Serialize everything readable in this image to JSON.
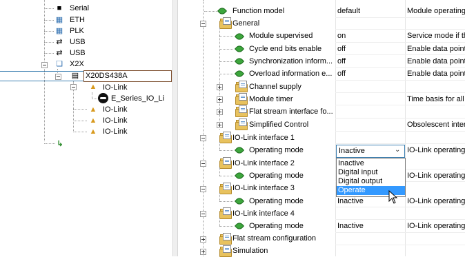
{
  "left_tree": {
    "items": [
      {
        "label": "Serial",
        "icon": "serial-port-icon"
      },
      {
        "label": "ETH",
        "icon": "ethernet-icon"
      },
      {
        "label": "PLK",
        "icon": "powerlink-icon"
      },
      {
        "label": "USB",
        "icon": "usb-icon"
      },
      {
        "label": "USB",
        "icon": "usb-icon"
      },
      {
        "label": "X2X",
        "icon": "x2x-icon"
      },
      {
        "label": "X20DS438A",
        "icon": "module-icon"
      },
      {
        "label": "IO-Link",
        "icon": "io-link-icon"
      },
      {
        "label": "E_Series_IO_Li",
        "icon": "sensor-icon"
      },
      {
        "label": "IO-Link",
        "icon": "io-link-icon"
      },
      {
        "label": "IO-Link",
        "icon": "io-link-icon"
      },
      {
        "label": "IO-Link",
        "icon": "io-link-icon"
      }
    ]
  },
  "config_rows": [
    {
      "name": "Function model",
      "value": "default",
      "description": "Module operating"
    },
    {
      "name": "General",
      "value": "",
      "description": ""
    },
    {
      "name": "Module supervised",
      "value": "on",
      "description": "Service mode if th"
    },
    {
      "name": "Cycle end bits enable",
      "value": "off",
      "description": "Enable data point"
    },
    {
      "name": "Synchronization inform...",
      "value": "off",
      "description": "Enable data point"
    },
    {
      "name": "Overload information e...",
      "value": "off",
      "description": "Enable data point"
    },
    {
      "name": "Channel supply",
      "value": "",
      "description": ""
    },
    {
      "name": "Module timer",
      "value": "",
      "description": "Time basis for all s"
    },
    {
      "name": "Flat stream interface fo...",
      "value": "",
      "description": ""
    },
    {
      "name": "Simplified Control",
      "value": "",
      "description": "Obsolescent inter"
    },
    {
      "name": "IO-Link interface 1",
      "value": "",
      "description": ""
    },
    {
      "name": "Operating mode",
      "value": "",
      "description": "IO-Link operating"
    },
    {
      "name": "IO-Link interface 2",
      "value": "",
      "description": ""
    },
    {
      "name": "Operating mode",
      "value": "",
      "description": "IO-Link operating"
    },
    {
      "name": "IO-Link interface 3",
      "value": "",
      "description": ""
    },
    {
      "name": "Operating mode",
      "value": "Inactive",
      "description": "IO-Link operating"
    },
    {
      "name": "IO-Link interface 4",
      "value": "",
      "description": ""
    },
    {
      "name": "Operating mode",
      "value": "Inactive",
      "description": "IO-Link operating"
    },
    {
      "name": "Flat stream configuration",
      "value": "",
      "description": ""
    },
    {
      "name": "Simulation",
      "value": "",
      "description": ""
    }
  ],
  "dropdown": {
    "selected": "Inactive",
    "options": [
      "Inactive",
      "Digital input",
      "Digital output",
      "Operate"
    ],
    "highlighted_option": "Operate"
  },
  "colors": {
    "selection": "#3399ff",
    "folder": "#e8c25e",
    "leaf": "#3da63d",
    "focus_border": "#3c7fb1"
  }
}
